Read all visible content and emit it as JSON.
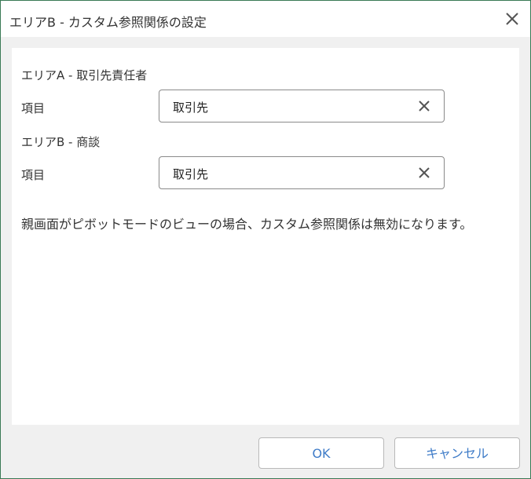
{
  "dialog": {
    "title": "エリアB - カスタム参照関係の設定",
    "close_icon": "close-icon"
  },
  "area_a": {
    "heading": "エリアA - 取引先責任者",
    "field_label": "項目",
    "field_value": "取引先",
    "clear_icon": "clear-icon"
  },
  "area_b": {
    "heading": "エリアB - 商談",
    "field_label": "項目",
    "field_value": "取引先",
    "clear_icon": "clear-icon"
  },
  "notice": "親画面がピボットモードのビューの場合、カスタム参照関係は無効になります。",
  "buttons": {
    "ok_label": "OK",
    "cancel_label": "キャンセル"
  },
  "colors": {
    "border_accent": "#3a7a55",
    "button_text": "#3f7cc8",
    "footer_background": "#f0f0f0"
  }
}
